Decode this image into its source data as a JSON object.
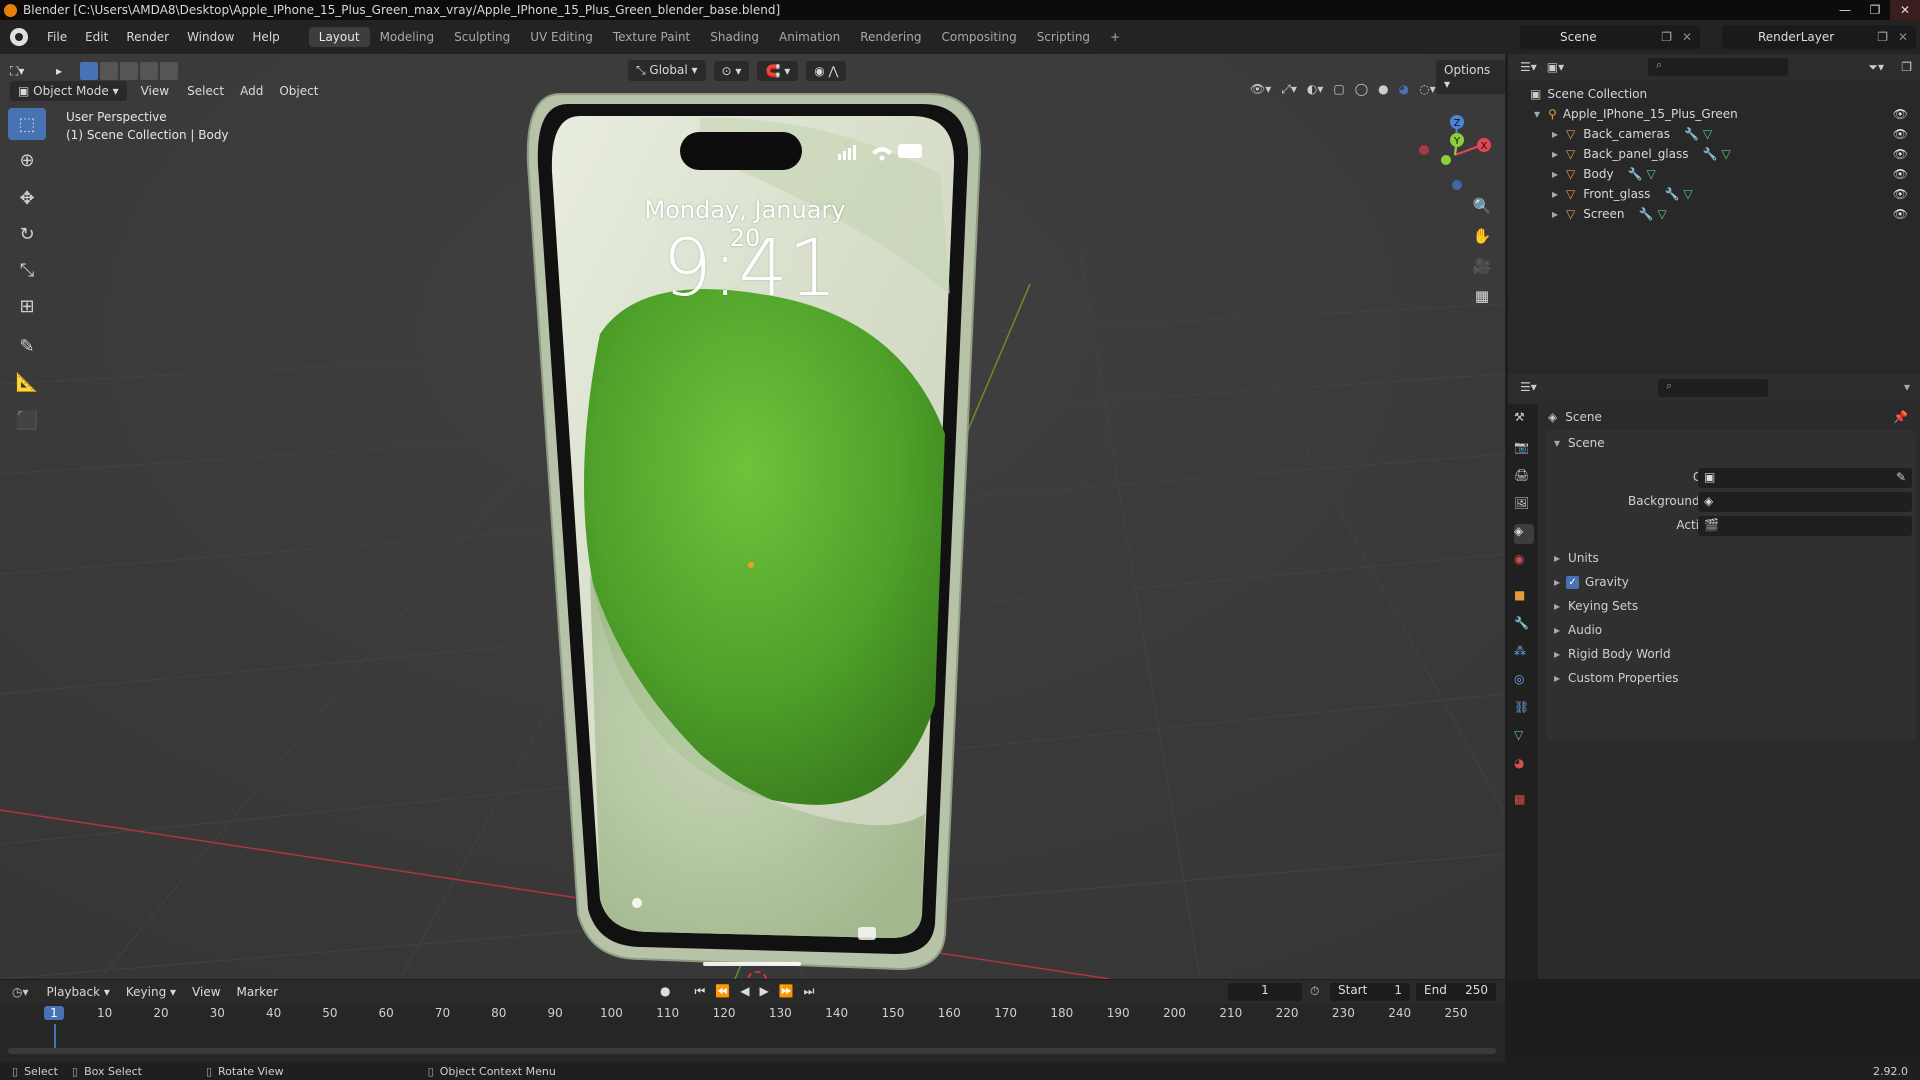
{
  "window": {
    "title": "Blender [C:\\Users\\AMDA8\\Desktop\\Apple_IPhone_15_Plus_Green_max_vray/Apple_IPhone_15_Plus_Green_blender_base.blend]",
    "controls": [
      "—",
      "❐",
      "✕"
    ]
  },
  "menu": {
    "items": [
      "File",
      "Edit",
      "Render",
      "Window",
      "Help"
    ]
  },
  "workspaces": {
    "tabs": [
      "Layout",
      "Modeling",
      "Sculpting",
      "UV Editing",
      "Texture Paint",
      "Shading",
      "Animation",
      "Rendering",
      "Compositing",
      "Scripting"
    ],
    "active": "Layout",
    "add": "+"
  },
  "scene_selector": {
    "value": "Scene"
  },
  "renderlayer_selector": {
    "value": "RenderLayer"
  },
  "viewport": {
    "mode": "Object Mode",
    "menus": [
      "View",
      "Select",
      "Add",
      "Object"
    ],
    "transform_orientation": "Global",
    "options": "Options",
    "info_line1": "User Perspective",
    "info_line2": "(1) Scene Collection | Body",
    "gizmo_axes": {
      "x": "X",
      "y": "Y",
      "z": "Z"
    },
    "phone": {
      "date": "Monday, January 20",
      "time": "9:41"
    }
  },
  "outliner": {
    "root": "Scene Collection",
    "collection": "Apple_IPhone_15_Plus_Green",
    "objects": [
      "Back_cameras",
      "Back_panel_glass",
      "Body",
      "Front_glass",
      "Screen"
    ]
  },
  "properties": {
    "header": "Scene",
    "panel_title": "Scene",
    "fields": [
      {
        "label": "Camera"
      },
      {
        "label": "Background Scene"
      },
      {
        "label": "Active Clip"
      }
    ],
    "sections": [
      "Units",
      "Gravity",
      "Keying Sets",
      "Audio",
      "Rigid Body World",
      "Custom Properties"
    ],
    "gravity_checked": true
  },
  "timeline": {
    "menus": [
      "Playback",
      "Keying",
      "View",
      "Marker"
    ],
    "current_frame": "1",
    "start_label": "Start",
    "start": "1",
    "end_label": "End",
    "end": "250",
    "ticks": [
      "1",
      "10",
      "20",
      "30",
      "40",
      "50",
      "60",
      "70",
      "80",
      "90",
      "100",
      "110",
      "120",
      "130",
      "140",
      "150",
      "160",
      "170",
      "180",
      "190",
      "200",
      "210",
      "220",
      "230",
      "240",
      "250"
    ]
  },
  "statusbar": {
    "items": [
      "Select",
      "Box Select",
      "Rotate View",
      "Object Context Menu"
    ],
    "version": "2.92.0"
  },
  "colors": {
    "accent": "#4772b3",
    "x_axis": "#e34555",
    "y_axis": "#8ccf3a",
    "z_axis": "#4c84db",
    "phone_green": "#5aa82c"
  }
}
